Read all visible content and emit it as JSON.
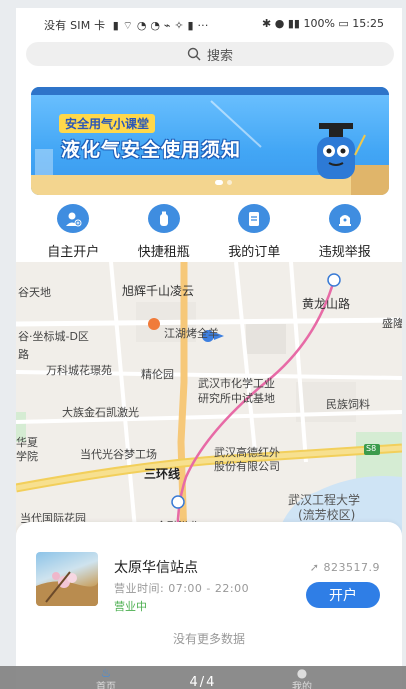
{
  "status_bar": {
    "left": "没有 SIM 卡",
    "battery": "100%",
    "time": "15:25"
  },
  "search": {
    "placeholder": "搜索"
  },
  "banner": {
    "tag": "安全用气小课堂",
    "headline": "液化气安全使用须知"
  },
  "actions": [
    {
      "label": "自主开户",
      "icon": "user-add-icon"
    },
    {
      "label": "快捷租瓶",
      "icon": "gas-cylinder-icon"
    },
    {
      "label": "我的订单",
      "icon": "order-list-icon"
    },
    {
      "label": "违规举报",
      "icon": "report-icon"
    }
  ],
  "map": {
    "labels": [
      "谷天地",
      "旭辉千山凌云",
      "黄龙山路",
      "盛隆",
      "谷·坐标城-D区",
      "江湖烤全羊",
      "路",
      "万科城花璟苑",
      "精伦园",
      "武汉市化学工业",
      "研究所中试基地",
      "民族饲料",
      "大族金石凯激光",
      "华夏",
      "学院",
      "当代光谷梦工场",
      "武汉高德红外",
      "股份有限公司",
      "三环线",
      "S8",
      "武汉工程大学",
      "(流芳校区)",
      "当代国际花园",
      "金融港北"
    ]
  },
  "station": {
    "name": "太原华信站点",
    "hours": "营业时间: 07:00 - 22:00",
    "status": "营业中",
    "distance": "823517.9",
    "button": "开户"
  },
  "list_footer": "没有更多数据",
  "tabbar": {
    "pager": "4/4",
    "tabs": [
      "首页",
      "我的"
    ]
  },
  "colors": {
    "primary": "#2f7ee6",
    "open_status": "#4caf50",
    "banner_tag": "#ffd84a"
  }
}
